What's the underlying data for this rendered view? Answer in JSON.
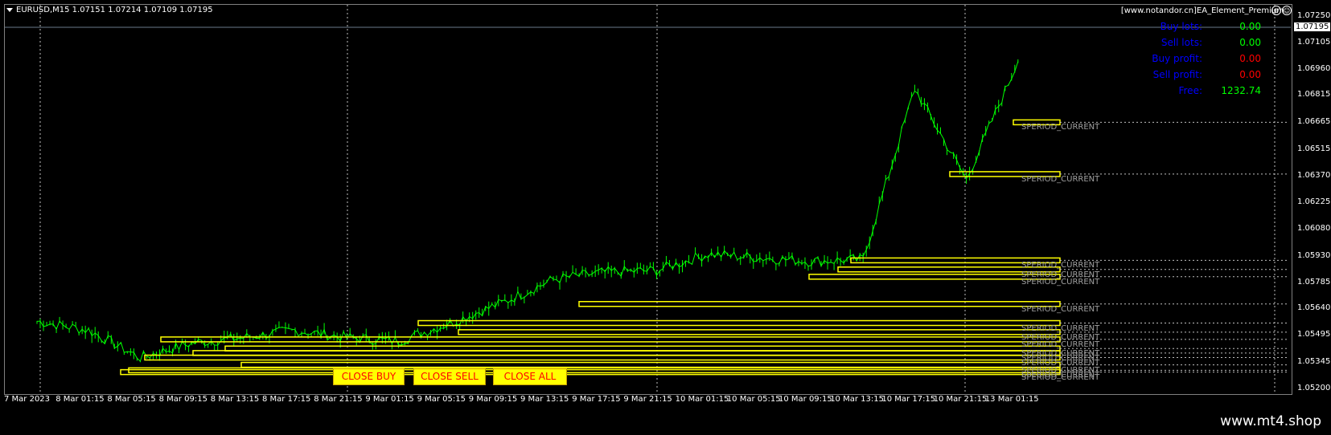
{
  "header": {
    "symbol_line": "EURUSD,M15  1.07151 1.07214 1.07109 1.07195",
    "ea_name": "[www.notandor.cn]EA_Element_Premium"
  },
  "info_panel": {
    "buy_lots_label": "Buy lots:",
    "buy_lots_value": "0.00",
    "sell_lots_label": "Sell lots:",
    "sell_lots_value": "0.00",
    "buy_profit_label": "Buy profit:",
    "buy_profit_value": "0.00",
    "sell_profit_label": "Sell profit:",
    "sell_profit_value": "0.00",
    "free_label": "Free:",
    "free_value": "1232.74"
  },
  "price_axis": {
    "current_price": "1.07195",
    "ticks": [
      "1.07250",
      "1.07105",
      "1.06960",
      "1.06815",
      "1.06665",
      "1.06515",
      "1.06370",
      "1.06225",
      "1.06080",
      "1.05930",
      "1.05785",
      "1.05640",
      "1.05495",
      "1.05345",
      "1.05200"
    ]
  },
  "time_axis": {
    "ticks": [
      "7 Mar 2023",
      "8 Mar 01:15",
      "8 Mar 05:15",
      "8 Mar 09:15",
      "8 Mar 13:15",
      "8 Mar 17:15",
      "8 Mar 21:15",
      "9 Mar 01:15",
      "9 Mar 05:15",
      "9 Mar 09:15",
      "9 Mar 13:15",
      "9 Mar 17:15",
      "9 Mar 21:15",
      "10 Mar 01:15",
      "10 Mar 05:15",
      "10 Mar 09:15",
      "10 Mar 13:15",
      "10 Mar 17:15",
      "10 Mar 21:15",
      "13 Mar 01:15"
    ]
  },
  "buttons": {
    "close_buy": "CLOSE BUY",
    "close_sell": "CLOSE SELL",
    "close_all": "CLOSE ALL"
  },
  "level_label": "SPERIOD_CURRENT",
  "watermark": "www.mt4.shop",
  "colors": {
    "background": "#000000",
    "candle": "#00ff00",
    "level_box": "#ffff00",
    "button_bg": "#ffff00",
    "button_text": "#ff0000",
    "info_label": "#0000ff",
    "profit_zero_buy_sell_lots": "#00ff00",
    "profit_value": "#ff0000"
  },
  "chart_data": {
    "type": "line",
    "title": "EURUSD,M15",
    "ylim": [
      1.052,
      1.0725
    ],
    "x": [
      "7 Mar 2023",
      "8 Mar 01:15",
      "8 Mar 05:15",
      "8 Mar 09:15",
      "8 Mar 13:15",
      "8 Mar 17:15",
      "8 Mar 21:15",
      "9 Mar 01:15",
      "9 Mar 05:15",
      "9 Mar 09:15",
      "9 Mar 13:15",
      "9 Mar 17:15",
      "9 Mar 21:15",
      "10 Mar 01:15",
      "10 Mar 05:15",
      "10 Mar 09:15",
      "10 Mar 13:15",
      "10 Mar 17:15",
      "10 Mar 21:15",
      "13 Mar 01:15"
    ],
    "series": [
      {
        "values": [
          1.0557,
          1.0552,
          1.0537,
          1.0545,
          1.0548,
          1.0552,
          1.0548,
          1.0546,
          1.0556,
          1.0567,
          1.058,
          1.0584,
          1.0585,
          1.0594,
          1.0592,
          1.059,
          1.0591,
          1.0685,
          1.0635,
          1.07
        ]
      }
    ],
    "levels": [
      1.06665,
      1.0638,
      1.05905,
      1.05855,
      1.05815,
      1.05665,
      1.0556,
      1.0551,
      1.0547,
      1.0542,
      1.05395,
      1.0537,
      1.0533,
      1.053,
      1.0529
    ]
  }
}
